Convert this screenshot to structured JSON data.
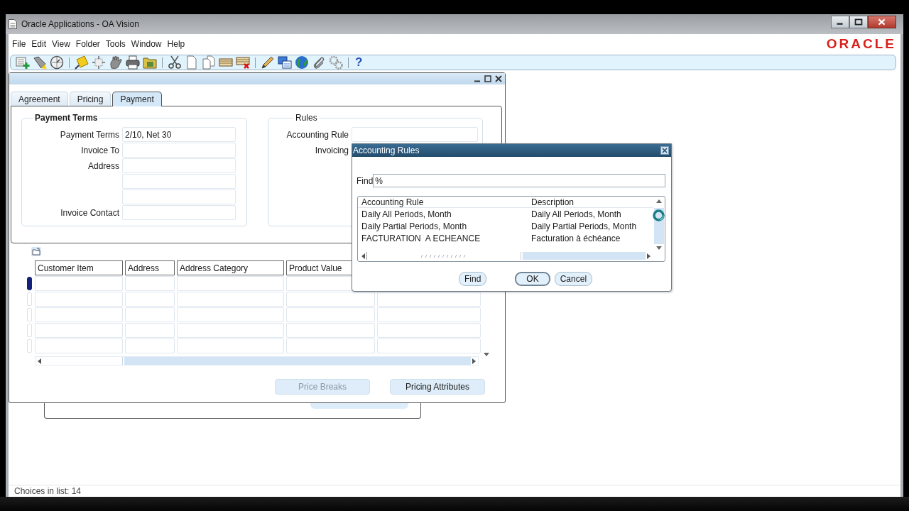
{
  "window": {
    "title": "Oracle Applications - OA Vision"
  },
  "menu": [
    {
      "label": "File"
    },
    {
      "label": "Edit"
    },
    {
      "label": "View"
    },
    {
      "label": "Folder"
    },
    {
      "label": "Tools"
    },
    {
      "label": "Window"
    },
    {
      "label": "Help"
    }
  ],
  "logo": "ORACLE",
  "toolbar": {
    "help_label": "?"
  },
  "form": {
    "tabs": [
      {
        "label": "Agreement",
        "selected": false
      },
      {
        "label": "Pricing",
        "selected": false
      },
      {
        "label": "Payment",
        "selected": true
      }
    ],
    "payment_terms": {
      "title": "Payment Terms",
      "fields": [
        {
          "kind": "labeled",
          "label": "Payment Terms",
          "value": "2/10, Net 30"
        },
        {
          "kind": "labeled",
          "label": "Invoice To"
        },
        {
          "kind": "labeled",
          "label": "Address"
        },
        {
          "kind": "continuation"
        },
        {
          "kind": "continuation"
        },
        {
          "kind": "labeled",
          "label": "Invoice Contact"
        }
      ]
    },
    "rules": {
      "title": "Rules",
      "fields": [
        {
          "kind": "labeled",
          "label": "Accounting Rule"
        },
        {
          "kind": "label_only",
          "label": "Invoicing"
        }
      ]
    },
    "table": {
      "columns": [
        {
          "kind": "titled",
          "heading": "Customer Item"
        },
        {
          "kind": "titled",
          "heading": "Address"
        },
        {
          "kind": "titled",
          "heading": "Address Category"
        },
        {
          "kind": "titled",
          "heading": "Product Value"
        },
        {
          "kind": "covered"
        }
      ],
      "rows": [
        {
          "current": true
        },
        {
          "current": false
        },
        {
          "current": false
        },
        {
          "current": false
        },
        {
          "current": false
        }
      ]
    },
    "buttons": [
      {
        "label": "Price Breaks",
        "disabled": true
      },
      {
        "label": "Pricing Attributes",
        "disabled": false
      }
    ]
  },
  "dialog": {
    "title": "Accounting Rules",
    "find_label": "Find",
    "find_value": "%",
    "list": {
      "columns": [
        "Accounting Rule",
        "Description"
      ],
      "rows": [
        {
          "cells": [
            "Daily All Periods, Month",
            "Daily All Periods, Month"
          ],
          "selected": false
        },
        {
          "cells": [
            "Daily Partial Periods, Month",
            "Daily Partial Periods, Month"
          ],
          "selected": false
        },
        {
          "cells": [
            "FACTURATION  A ECHEANCE",
            "Facturation à échéance"
          ],
          "selected": false
        }
      ]
    },
    "buttons": [
      {
        "label": "Find",
        "default": false
      },
      {
        "label": "OK",
        "default": true
      },
      {
        "label": "Cancel",
        "default": false
      }
    ]
  },
  "status_bar": {
    "text": "Choices in list: 14"
  }
}
